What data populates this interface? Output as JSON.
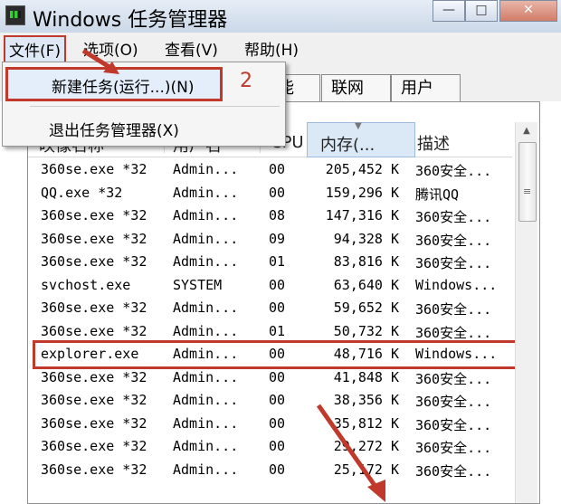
{
  "window": {
    "title": "Windows 任务管理器",
    "buttons": {
      "minimize": "—",
      "maximize": "□",
      "close": "✕"
    }
  },
  "menubar": {
    "file": "文件(F)",
    "options": "选项(O)",
    "view": "查看(V)",
    "help": "帮助(H)"
  },
  "file_menu": {
    "new_task": "新建任务(运行...)(N)",
    "exit": "退出任务管理器(X)",
    "step_label": "2"
  },
  "tabs": {
    "performance_partial": "能",
    "network": "联网",
    "users": "用户"
  },
  "columns": {
    "image_name": "映像名称",
    "user_name": "用户名",
    "cpu": "CPU",
    "memory": "内存(...",
    "description": "描述"
  },
  "processes": [
    {
      "name": "360se.exe *32",
      "user": "Admin...",
      "cpu": "00",
      "mem": "205,452 K",
      "desc": "360安全..."
    },
    {
      "name": "QQ.exe *32",
      "user": "Admin...",
      "cpu": "00",
      "mem": "159,296 K",
      "desc": "腾讯QQ"
    },
    {
      "name": "360se.exe *32",
      "user": "Admin...",
      "cpu": "08",
      "mem": "147,316 K",
      "desc": "360安全..."
    },
    {
      "name": "360se.exe *32",
      "user": "Admin...",
      "cpu": "09",
      "mem": "94,328 K",
      "desc": "360安全..."
    },
    {
      "name": "360se.exe *32",
      "user": "Admin...",
      "cpu": "01",
      "mem": "83,816 K",
      "desc": "360安全..."
    },
    {
      "name": "svchost.exe",
      "user": "SYSTEM",
      "cpu": "00",
      "mem": "63,640 K",
      "desc": "Windows..."
    },
    {
      "name": "360se.exe *32",
      "user": "Admin...",
      "cpu": "00",
      "mem": "59,652 K",
      "desc": "360安全..."
    },
    {
      "name": "360se.exe *32",
      "user": "Admin...",
      "cpu": "01",
      "mem": "50,732 K",
      "desc": "360安全..."
    },
    {
      "name": "explorer.exe",
      "user": "Admin...",
      "cpu": "00",
      "mem": "48,716 K",
      "desc": "Windows..."
    },
    {
      "name": "360se.exe *32",
      "user": "Admin...",
      "cpu": "00",
      "mem": "41,848 K",
      "desc": "360安全..."
    },
    {
      "name": "360se.exe *32",
      "user": "Admin...",
      "cpu": "00",
      "mem": "38,356 K",
      "desc": "360安全..."
    },
    {
      "name": "360se.exe *32",
      "user": "Admin...",
      "cpu": "00",
      "mem": "35,812 K",
      "desc": "360安全..."
    },
    {
      "name": "360se.exe *32",
      "user": "Admin...",
      "cpu": "00",
      "mem": "29,272 K",
      "desc": "360安全..."
    },
    {
      "name": "360se.exe *32",
      "user": "Admin...",
      "cpu": "00",
      "mem": "25,172 K",
      "desc": "360安全..."
    }
  ],
  "highlighted_process": "explorer.exe",
  "colors": {
    "annotation": "#c0392b",
    "selected_menu": "#dfe9f6",
    "sorted_column": "#dbe9f7"
  }
}
